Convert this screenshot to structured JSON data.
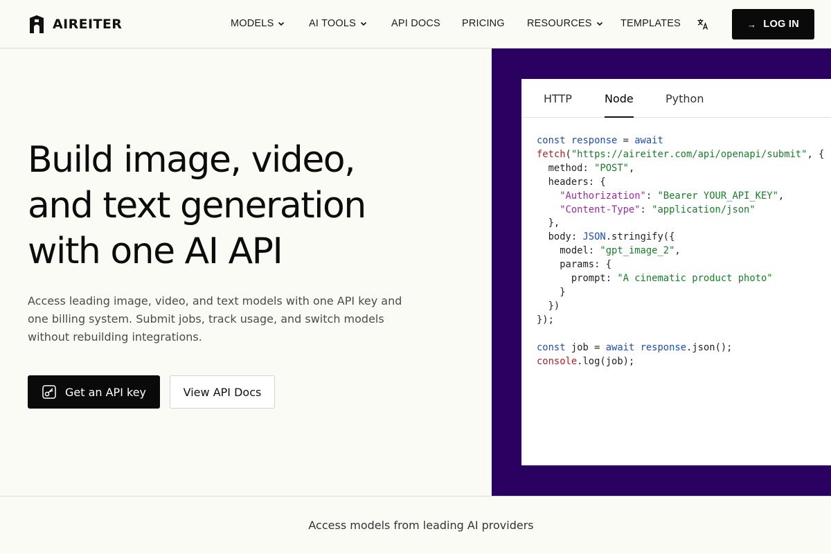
{
  "brand": {
    "name": "AIREITER"
  },
  "nav": {
    "items": [
      {
        "label": "MODELS",
        "dropdown": true
      },
      {
        "label": "AI TOOLS",
        "dropdown": true
      },
      {
        "label": "API DOCS",
        "dropdown": false
      },
      {
        "label": "PRICING",
        "dropdown": false
      },
      {
        "label": "RESOURCES",
        "dropdown": true
      },
      {
        "label": "TEMPLATES",
        "dropdown": false
      }
    ],
    "translate_icon": "translate-icon",
    "login": {
      "arrow": "→",
      "label": "LOG IN"
    }
  },
  "hero": {
    "title_lines": [
      "Build image, video,",
      "and text generation",
      "with one AI API"
    ],
    "subtitle": "Access leading image, video, and text models with one API key and one billing system. Submit jobs, track usage, and switch models without rebuilding integrations.",
    "primary_button": "Get an API key",
    "secondary_button": "View API Docs"
  },
  "code_panel": {
    "tabs": [
      "HTTP",
      "Node",
      "Python"
    ],
    "active_tab": "Node",
    "code": {
      "kw_const": "const",
      "kw_await": "await",
      "var_response": "response",
      "fn_fetch": "fetch",
      "url": "\"https://aireiter.com/api/openapi/submit\"",
      "method_key": "method",
      "method_val": "\"POST\"",
      "headers_key": "headers",
      "auth_key": "\"Authorization\"",
      "auth_val": "\"Bearer YOUR_API_KEY\"",
      "ct_key": "\"Content-Type\"",
      "ct_val": "\"application/json\"",
      "body_key": "body",
      "json_obj": "JSON",
      "stringify": "stringify",
      "model_key": "model",
      "model_val": "\"gpt_image_2\"",
      "params_key": "params",
      "prompt_key": "prompt",
      "prompt_val": "\"A cinematic product photo\"",
      "var_job": "job",
      "json_fn": "json",
      "console": "console",
      "log": "log"
    }
  },
  "providers": {
    "label": "Access models from leading AI providers"
  },
  "colors": {
    "accent_panel": "#2a0060",
    "primary": "#0a0a0a",
    "background": "#fbfbf6"
  }
}
